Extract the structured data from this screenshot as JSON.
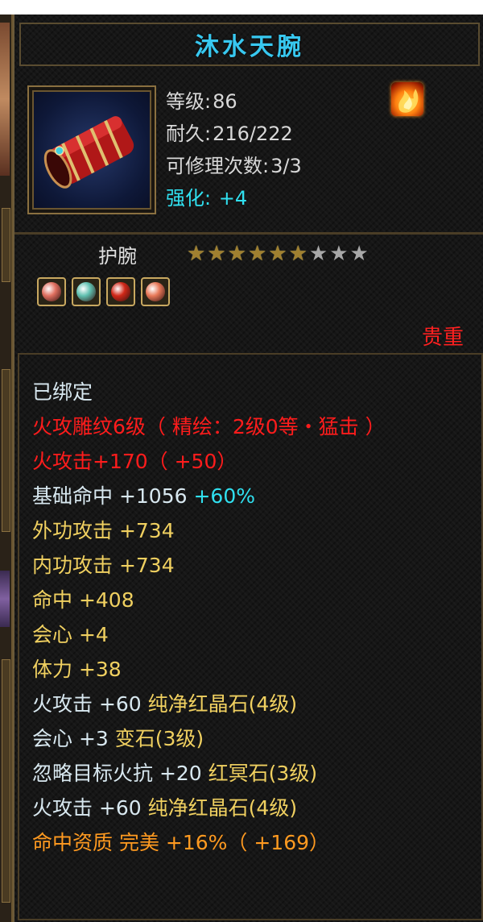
{
  "item": {
    "name": "沐水天腕",
    "level_label": "等级:",
    "level": "86",
    "durability_label": "耐久:",
    "durability": "216/222",
    "repair_label": "可修理次数:",
    "repair": "3/3",
    "enhance_label": "强化:",
    "enhance": "+4",
    "type": "护腕",
    "rarity": "贵重",
    "stars_total": 9,
    "stars_filled": 6,
    "gems": [
      {
        "icon": "gem-icon",
        "color": "#e07060"
      },
      {
        "icon": "gem-icon",
        "color": "#60c0b0"
      },
      {
        "icon": "gem-icon",
        "color": "#d02818"
      },
      {
        "icon": "gem-icon",
        "color": "#e87858"
      }
    ]
  },
  "props": {
    "bound": "已绑定",
    "engrave": "火攻雕纹6级（ 精绘：2级0等・猛击 ）",
    "fire_attack_main": "火攻击+170（ +50）",
    "base_hit_label": "基础命中 ",
    "base_hit_val": "+1056 ",
    "base_hit_pct": "+60%",
    "ext_atk": "外功攻击 +734",
    "int_atk": "内功攻击 +734",
    "hit": "命中 +408",
    "crit": "会心 +4",
    "stamina": "体力 +38",
    "gem1_stat": "火攻击 +60 ",
    "gem1_name": "纯净红晶石(4级)",
    "gem2_stat": "会心 +3 ",
    "gem2_name": "变石(3级)",
    "gem3_stat": "忽略目标火抗 +20 ",
    "gem3_name": "红冥石(3级)",
    "gem4_stat": "火攻击 +60 ",
    "gem4_name": "纯净红晶石(4级)",
    "quality": "命中资质   完美 +16%（ +169）"
  },
  "colors": {
    "title": "#38c8f0",
    "red": "#ff1c1c",
    "yellow": "#f0d060",
    "cyan": "#30e0f0",
    "orange": "#ff9a20"
  }
}
